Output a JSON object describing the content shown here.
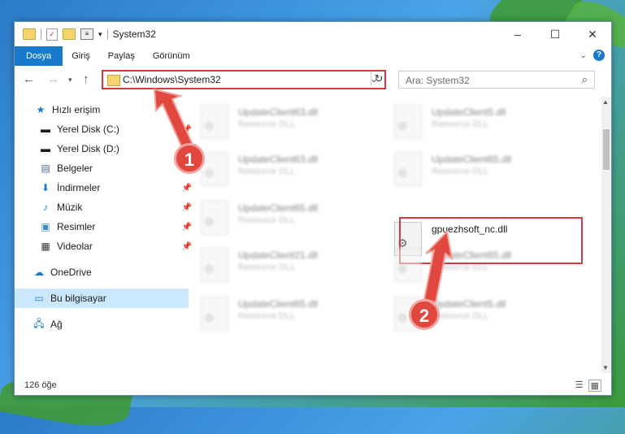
{
  "window": {
    "title": "System32"
  },
  "ribbon": {
    "tabs": [
      "Dosya",
      "Giriş",
      "Paylaş",
      "Görünüm"
    ]
  },
  "nav": {
    "address": "C:\\Windows\\System32",
    "search_placeholder": "Ara: System32"
  },
  "sidebar": {
    "items": [
      {
        "label": "Hızlı erişim",
        "icon": "star-icon",
        "pinned": false
      },
      {
        "label": "Yerel Disk (C:)",
        "icon": "drive-icon",
        "pinned": true
      },
      {
        "label": "Yerel Disk (D:)",
        "icon": "drive-icon",
        "pinned": true
      },
      {
        "label": "Belgeler",
        "icon": "documents-icon",
        "pinned": true
      },
      {
        "label": "İndirmeler",
        "icon": "download-icon",
        "pinned": true
      },
      {
        "label": "Müzik",
        "icon": "music-icon",
        "pinned": true
      },
      {
        "label": "Resimler",
        "icon": "pictures-icon",
        "pinned": true
      },
      {
        "label": "Videolar",
        "icon": "videos-icon",
        "pinned": true
      },
      {
        "label": "OneDrive",
        "icon": "cloud-icon",
        "pinned": false
      },
      {
        "label": "Bu bilgisayar",
        "icon": "computer-icon",
        "pinned": false,
        "selected": true
      },
      {
        "label": "Ağ",
        "icon": "network-icon",
        "pinned": false
      }
    ]
  },
  "files": [
    {
      "name": "UpdateClient63.dll",
      "type": "Resource DLL",
      "blurred": true
    },
    {
      "name": "UpdateClient5.dll",
      "type": "Resource DLL",
      "blurred": true
    },
    {
      "name": "UpdateClient63.dll",
      "type": "Resource DLL",
      "blurred": true
    },
    {
      "name": "UpdateClient65.dll",
      "type": "Resource DLL",
      "blurred": true
    },
    {
      "name": "UpdateClient65.dll",
      "type": "Resource DLL",
      "blurred": true
    },
    {
      "name": "gpuezhsoft_nc.dll",
      "type": "",
      "blurred": false,
      "highlighted": true
    },
    {
      "name": "UpdateClient21.dll",
      "type": "Resource DLL",
      "blurred": true
    },
    {
      "name": "UpdateClient65.dll",
      "type": "Resource DLL",
      "blurred": true
    },
    {
      "name": "UpdateClient65.dll",
      "type": "Resource DLL",
      "blurred": true
    },
    {
      "name": "UpdateClient5.dll",
      "type": "Resource DLL",
      "blurred": true
    }
  ],
  "status": {
    "count": "126 öğe"
  },
  "callouts": [
    "1",
    "2"
  ],
  "colors": {
    "accent": "#1979ca",
    "highlight": "#d9363e",
    "callout": "#e0483f"
  }
}
